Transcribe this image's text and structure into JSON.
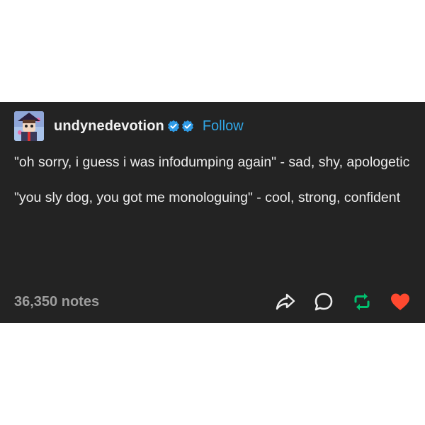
{
  "post": {
    "author": {
      "username": "undynedevotion",
      "follow_label": "Follow",
      "avatar_icon": "avatar-icon",
      "badges": [
        "verified-badge-icon",
        "verified-badge-icon"
      ]
    },
    "body": [
      "\"oh sorry, i guess i was infodumping again\" - sad, shy, apologetic",
      "\"you sly dog, you got me monologuing\" - cool, strong, confident"
    ],
    "footer": {
      "notes": "36,350 notes",
      "actions": [
        "share-icon",
        "reply-icon",
        "reblog-icon",
        "like-icon"
      ]
    }
  },
  "colors": {
    "background": "#232323",
    "text": "#ececec",
    "follow": "#31a6e6",
    "notes": "#9d9d9d",
    "reblog": "#00c06e",
    "like": "#ff492f"
  }
}
